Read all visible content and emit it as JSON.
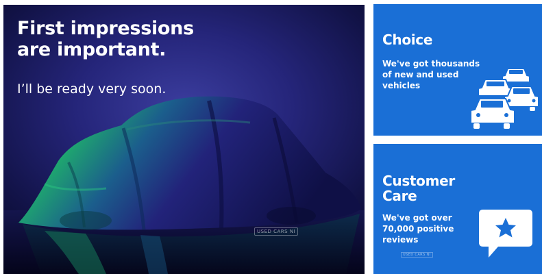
{
  "hero": {
    "title_line1": "First impressions",
    "title_line2": "are important.",
    "subtitle": "I’ll be ready very soon.",
    "watermark": "USED CARS NI",
    "covered_car_icon": "covered-car-icon"
  },
  "cards": {
    "choice": {
      "title": "Choice",
      "text_line1": "We've got thousands",
      "text_line2": "of new and used",
      "text_line3": "vehicles",
      "icon": "cars-icon"
    },
    "care": {
      "title_line1": "Customer",
      "title_line2": "Care",
      "text_line1": "We've got over",
      "text_line2": "70,000 positive",
      "text_line3": "reviews",
      "watermark": "USED CARS NI",
      "icon": "star-speech-bubble-icon"
    }
  },
  "colors": {
    "card_blue": "#1a6fd6",
    "hero_navy": "#1d1f66",
    "cloth_green": "#1fae6c",
    "star_blue": "#1a6fd6"
  }
}
